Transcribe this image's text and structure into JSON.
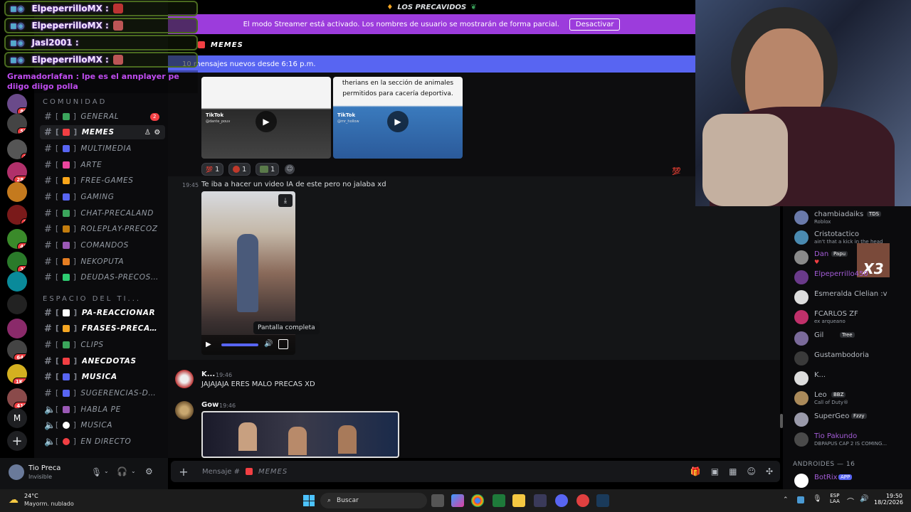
{
  "window": {
    "title": "LOS PRECAVIDOS"
  },
  "streamer_bar": {
    "text": "El modo Streamer está activado. Los nombres de usuario se mostrarán de forma parcial.",
    "button": "Desactivar"
  },
  "channel_header": {
    "name": "MEMES"
  },
  "new_messages_bar": {
    "text": "10 mensajes nuevos desde 6:16 p.m."
  },
  "overlay_chat": [
    {
      "user": "ElpeperrilloMX :"
    },
    {
      "user": "ElpeperrilloMX :"
    },
    {
      "user": "Jasl2001 :"
    },
    {
      "user": "ElpeperrilloMX :"
    },
    {
      "user": "Gramadorlafan :",
      "text": "lpe es el annplayer pe diigo diigo polla"
    }
  ],
  "server_badges": [
    "80",
    "55",
    "1",
    "284",
    "1",
    "41",
    "31",
    "644",
    "1K+",
    "419"
  ],
  "server_letter": "M",
  "categories": {
    "comunidad": "COMUNIDAD",
    "espacio": "ESPACIO DEL TI..."
  },
  "channels": [
    {
      "label": "GENERAL",
      "badge": "2",
      "color": "#3ba55c"
    },
    {
      "label": "MEMES",
      "color": "#f23f43"
    },
    {
      "label": "MULTIMEDIA",
      "color": "#5865f2"
    },
    {
      "label": "ARTE",
      "color": "#eb459e"
    },
    {
      "label": "FREE-GAMES",
      "color": "#faa61a"
    },
    {
      "label": "GAMING",
      "color": "#5865f2"
    },
    {
      "label": "CHAT-PRECALAND",
      "color": "#3ba55c"
    },
    {
      "label": "ROLEPLAY-PRECOZ",
      "color": "#c27c0e"
    },
    {
      "label": "COMANDOS",
      "color": "#9b59b6"
    },
    {
      "label": "NEKOPUTA",
      "color": "#e67e22"
    },
    {
      "label": "DEUDAS-PRECOSES",
      "color": "#2ecc71"
    }
  ],
  "channels2": [
    {
      "label": "PA-REACCIONAR",
      "color": "#ffffff"
    },
    {
      "label": "FRASES-PRECAVID...",
      "color": "#f5a623"
    },
    {
      "label": "CLIPS",
      "color": "#3ba55c"
    },
    {
      "label": "ANECDOTAS",
      "color": "#f23f43"
    },
    {
      "label": "MUSICA",
      "color": "#5865f2"
    },
    {
      "label": "SUGERENCIAS-DE-...",
      "color": "#5865f2"
    }
  ],
  "voice_channels": [
    {
      "label": "HABLA PE",
      "color": "#9b59b6"
    },
    {
      "label": "MUSICA",
      "color": "#ffffff"
    },
    {
      "label": "EN DIRECTO",
      "color": "#f23f43"
    }
  ],
  "messages": {
    "tiktok_caption": "therians en la sección de animales permitidos para cacería deportiva.",
    "tiktok_label": "TikTok",
    "tiktok_user1": "@dante_pouv",
    "tiktok_user2": "@mr_hollow",
    "reactions": [
      {
        "count": "1"
      },
      {
        "count": "1"
      },
      {
        "count": "1"
      }
    ],
    "msg1_time": "19:45",
    "msg1_text": "Te iba a hacer un video IA de este pero no jalaba xd",
    "tooltip": "Pantalla completa",
    "msg2_author": "K...",
    "msg2_time": "19:46",
    "msg2_text": "JAJAJAJA ERES MALO PRECAS XD",
    "msg3_author": "Gow",
    "msg3_time": "19:46"
  },
  "composer": {
    "placeholder": "Mensaje #",
    "channel": "MEMES"
  },
  "user_panel": {
    "name": "Tio Preca",
    "status": "Invisible"
  },
  "members": [
    {
      "name": "chambiadaiks",
      "tag": "TDS",
      "status": "Roblox",
      "color": "#b5bac1"
    },
    {
      "name": "Cristotactico",
      "status": "ain't that a kick in the head",
      "color": "#b5bac1"
    },
    {
      "name": "Dan",
      "tag": "Papu",
      "status": "",
      "color": "#a35cd6"
    },
    {
      "name": "Elpeperrillo450",
      "status": "",
      "color": "#a35cd6"
    },
    {
      "name": "Esmeralda Clelian :v",
      "status": "",
      "color": "#b5bac1"
    },
    {
      "name": "FCARLOS ZF",
      "status": "ex arqueano",
      "color": "#b5bac1"
    },
    {
      "name": "Gil",
      "tag": "Tree",
      "status": "",
      "color": "#b5bac1"
    },
    {
      "name": "Gustambodoria",
      "status": "",
      "color": "#b5bac1"
    },
    {
      "name": "K...",
      "status": "",
      "color": "#b5bac1"
    },
    {
      "name": "Leo",
      "tag": "BBZ",
      "status": "Call of Duty®",
      "color": "#b5bac1"
    },
    {
      "name": "SuperGeo",
      "tag": "Fzzy",
      "status": "",
      "color": "#b5bac1"
    },
    {
      "name": "Tio Pakundo",
      "status": "DBPAPUS CAP 2 IS COMING...",
      "color": "#a35cd6"
    }
  ],
  "members_category": "ANDROIDES — 16",
  "members_last": {
    "name": "BotRix",
    "tag": "APP"
  },
  "x3_text": "X3",
  "taskbar": {
    "weather_temp": "24°C",
    "weather_desc": "Mayorm. nublado",
    "search": "Buscar",
    "lang1": "ESP",
    "lang2": "LAA",
    "time": "19:50",
    "date": "18/2/2026"
  }
}
